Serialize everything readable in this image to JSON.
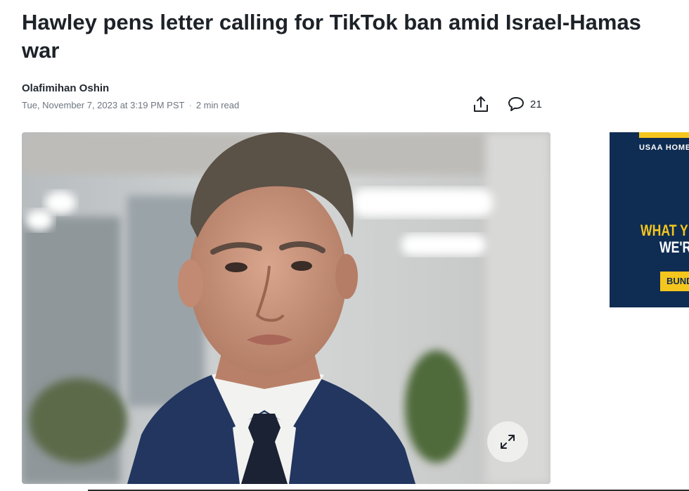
{
  "article": {
    "headline": "Hawley pens letter calling for TikTok ban amid Israel-Hamas war",
    "author": "Olafimihan Oshin",
    "date": "Tue, November 7, 2023 at 3:19 PM PST",
    "read_time": "2 min read",
    "separator": "·"
  },
  "actions": {
    "share_icon": "share-icon",
    "comment_icon": "comment-icon",
    "comment_count": "21"
  },
  "hero_image": {
    "description_icon": "person-photo",
    "expand_icon": "expand-icon"
  },
  "ad": {
    "brand": "USAA HOME",
    "line1": "WHAT Y",
    "line2": "WE'R",
    "cta": "BUND",
    "colors": {
      "background": "#0f2d53",
      "accent": "#f5c61d"
    }
  }
}
